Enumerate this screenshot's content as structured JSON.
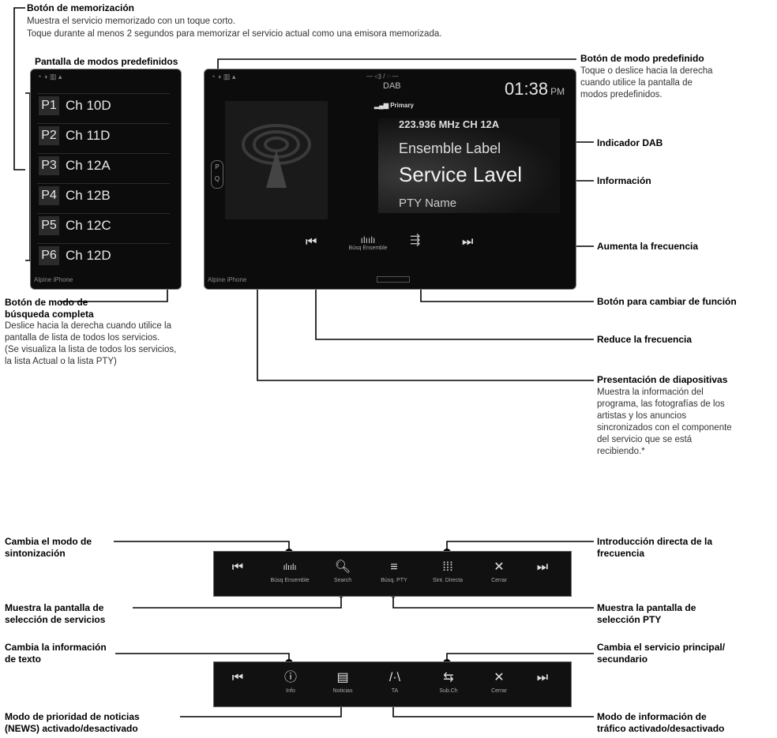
{
  "top": {
    "memo_title": "Botón de memorización",
    "memo_desc1": "Muestra el servicio memorizado con un toque corto.",
    "memo_desc2": "Toque durante al menos 2 segundos para memorizar el servicio actual como una emisora memorizada.",
    "preset_screen_title": "Pantalla de modos predefinidos"
  },
  "preset_screen": {
    "presets": [
      {
        "num": "P1",
        "ch": "Ch 10D"
      },
      {
        "num": "P2",
        "ch": "Ch 11D"
      },
      {
        "num": "P3",
        "ch": "Ch 12A"
      },
      {
        "num": "P4",
        "ch": "Ch 12B"
      },
      {
        "num": "P5",
        "ch": "Ch 12C"
      },
      {
        "num": "P6",
        "ch": "Ch 12D"
      }
    ],
    "device": "Alpine iPhone"
  },
  "main_screen": {
    "band": "DAB",
    "primary": "Primary",
    "time": "01:38",
    "ampm": "PM",
    "freq": "223.936 MHz  CH 12A",
    "ensemble": "Ensemble Label",
    "service": "Service Lavel",
    "pty": "PTY Name",
    "busq": "Búsq Ensemble",
    "device": "Alpine iPhone"
  },
  "labels": {
    "modo_pre_title": "Botón de modo predefinido",
    "modo_pre_desc": [
      "Toque o deslice hacia la derecha",
      "cuando utilice la pantalla de",
      "modos predefinidos."
    ],
    "dab_ind": "Indicador DAB",
    "info": "Información",
    "aumenta": "Aumenta la frecuencia",
    "cambiar_func": "Botón para cambiar de función",
    "reduce": "Reduce la frecuencia",
    "diapos_title": "Presentación de diapositivas",
    "diapos_desc": [
      "Muestra la información del",
      "programa, las fotografías de los",
      "artistas y los anuncios",
      "sincronizados con el componente",
      "del servicio que se está",
      "recibiendo.*"
    ],
    "busq_title": [
      "Botón de modo de",
      "búsqueda completa"
    ],
    "busq_desc": [
      "Deslice hacia la derecha cuando utilice la",
      "pantalla de lista de todos los servicios.",
      "(Se visualiza la lista de todos los servicios,",
      "la lista Actual o la lista PTY)"
    ]
  },
  "bar1": {
    "buttons": [
      "Búsq Ensemble",
      "Search",
      "Búsq. PTY",
      "Sint. Directa",
      "Cerrar"
    ],
    "left1": [
      "Cambia el modo de",
      "sintonización"
    ],
    "left2": [
      "Muestra la pantalla de",
      "selección de servicios"
    ],
    "right1": [
      "Introducción directa de la",
      "frecuencia"
    ],
    "right2": [
      "Muestra la pantalla de",
      "selección PTY"
    ]
  },
  "bar2": {
    "buttons": [
      "Info",
      "Noticias",
      "TA",
      "Sub.Ch",
      "Cerrar"
    ],
    "left1": [
      "Cambia la información",
      "de texto"
    ],
    "left2": [
      "Modo de prioridad de noticias",
      "(NEWS) activado/desactivado"
    ],
    "right1": [
      "Cambia el servicio principal/",
      "secundario"
    ],
    "right2": [
      "Modo de información de",
      "tráfico activado/desactivado"
    ]
  },
  "icons": [
    "prev-icon",
    "next-icon",
    "search-icon",
    "info-icon",
    "close-icon",
    "keypad-icon",
    "dab-antenna-icon"
  ]
}
